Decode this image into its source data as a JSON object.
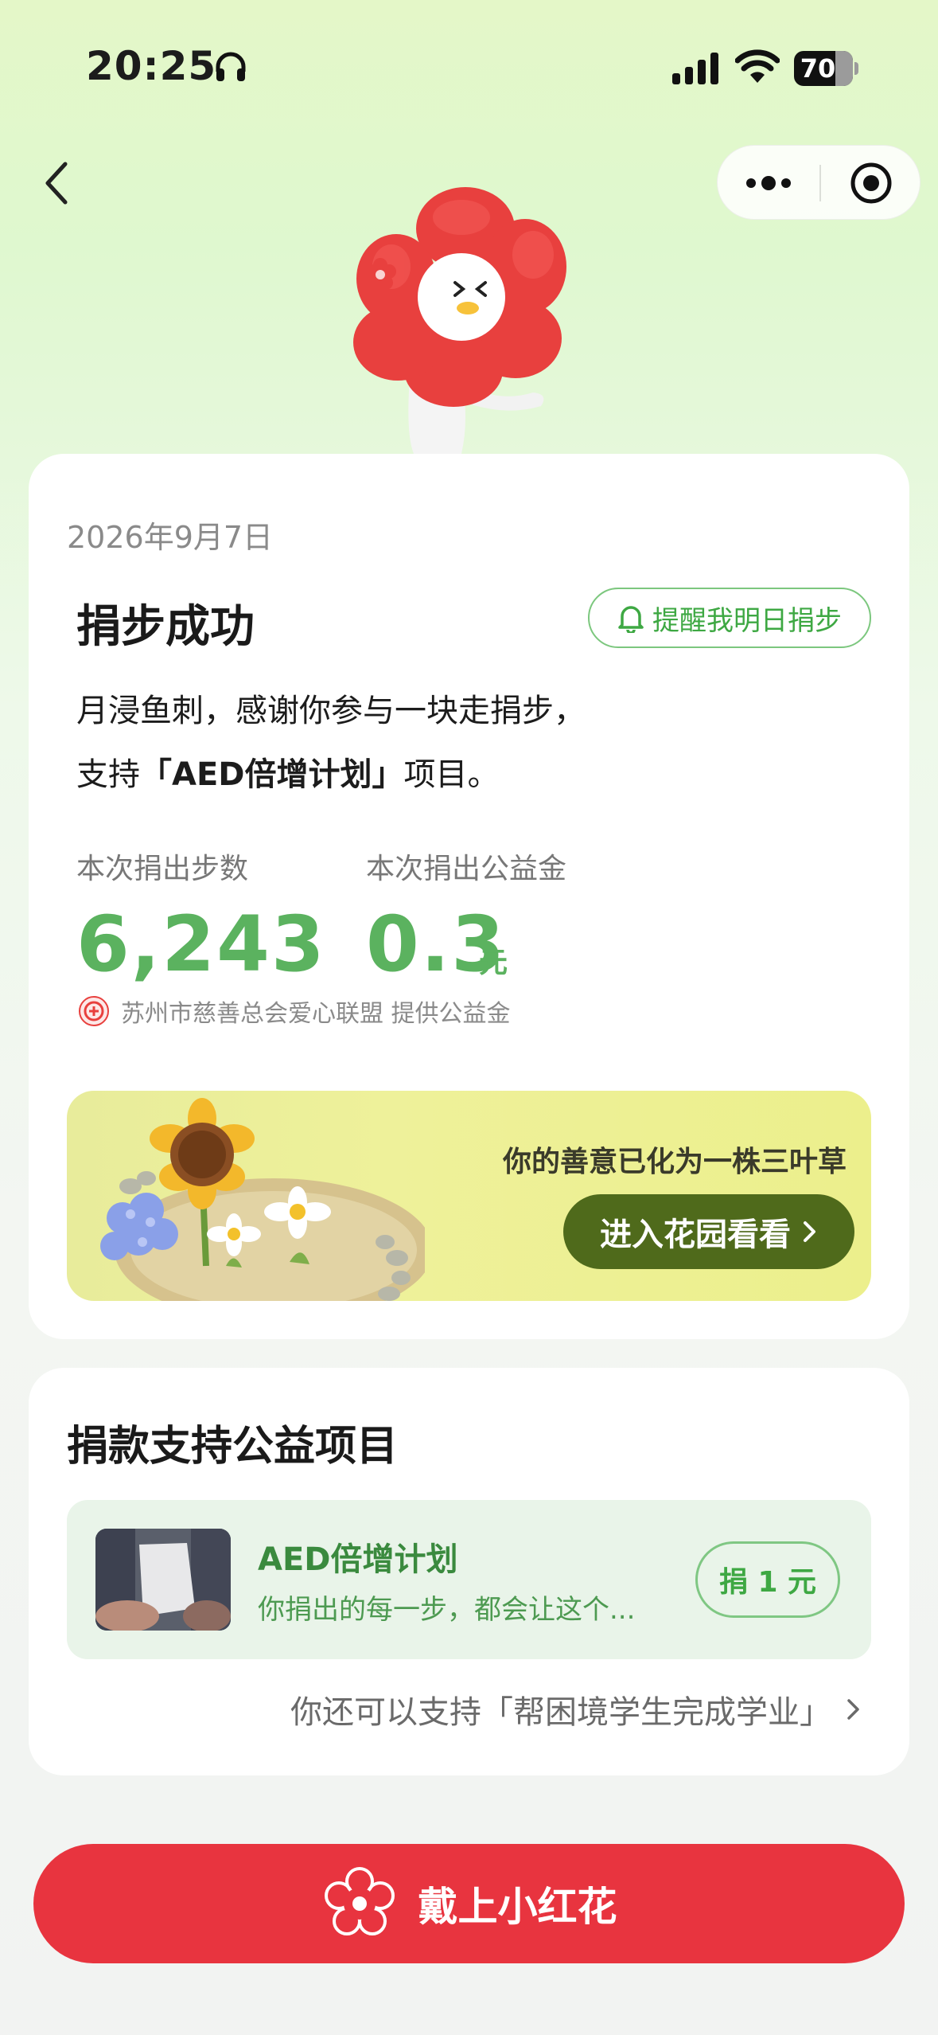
{
  "status_bar": {
    "time": "20:25",
    "battery": "70",
    "icons": [
      "headphones-icon",
      "signal-icon",
      "wifi-icon",
      "battery-icon"
    ]
  },
  "nav": {
    "back_icon": "chevron-left-icon",
    "more_icon": "more-dots-icon",
    "close_icon": "target-close-icon"
  },
  "result_card": {
    "date": "2026年9月7日",
    "title": "捐步成功",
    "remind_label": "提醒我明日捐步",
    "thanks_line1": "月浸鱼刺，感谢你参与一块走捐步，",
    "thanks_line2_prefix": "支持",
    "thanks_line2_project": "「AED倍增计划」",
    "thanks_line2_suffix": "项目。",
    "steps_label": "本次捐出步数",
    "steps_value": "6,243",
    "money_label": "本次捐出公益金",
    "money_value": "0.3",
    "money_unit": "元",
    "sponsor_text": "苏州市慈善总会爱心联盟 提供公益金",
    "garden_text": "你的善意已化为一株三叶草",
    "garden_button": "进入花园看看"
  },
  "support_card": {
    "title": "捐款支持公益项目",
    "project_name": "AED倍增计划",
    "project_desc": "你捐出的每一步，都会让这个...",
    "donate_label": "捐 1 元",
    "alt_project": "你还可以支持「帮困境学生完成学业」"
  },
  "footer": {
    "wear_label": "戴上小红花"
  },
  "colors": {
    "accent_green": "#5bb25f",
    "garden_button_bg": "#4f6a1b",
    "primary_red": "#e8343f"
  }
}
